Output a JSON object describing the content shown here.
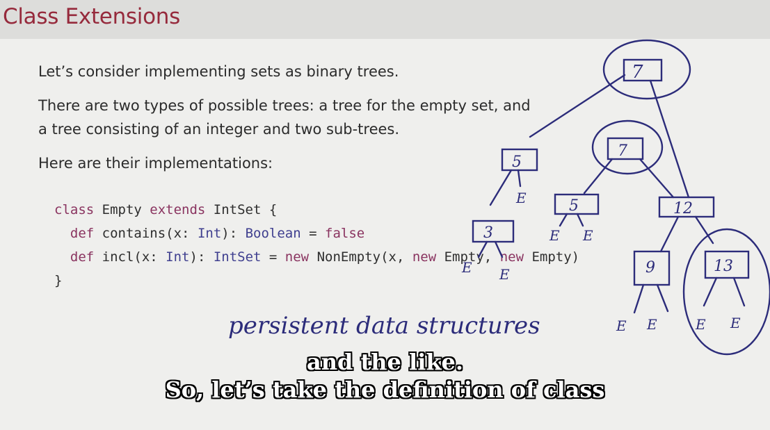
{
  "slide": {
    "title": "Class Extensions",
    "paragraphs": [
      "Let’s consider implementing sets as binary trees.",
      "There are two types of possible trees: a tree for the empty set, and",
      "a tree consisting of an integer and two sub-trees.",
      "Here are their implementations:"
    ],
    "code": {
      "line1": {
        "kw1": "class",
        "name": " Empty ",
        "kw2": "extends",
        "type": " IntSet",
        "rest": " {"
      },
      "line2": {
        "indent": "  ",
        "kw": "def",
        "sig": " contains(x: ",
        "type1": "Int",
        "mid": "): ",
        "type2": "Boolean",
        "eq": " = ",
        "val": "false"
      },
      "line3": {
        "indent": "  ",
        "kw": "def",
        "sig": " incl(x: ",
        "type1": "Int",
        "mid": "): ",
        "type2": "IntSet",
        "eq": " = ",
        "kw2": "new",
        "call": " NonEmpty(x, ",
        "kw3": "new",
        "e1": " Empty, ",
        "kw4": "new",
        "e2": " Empty)"
      },
      "line4": "}"
    }
  },
  "annotations": {
    "handwriting": "persistent data structures",
    "tree_nodes": [
      "7",
      "5",
      "7",
      "5",
      "12",
      "3",
      "9",
      "13"
    ],
    "empty_leaf": "E",
    "ink_color": "#2c2c7a"
  },
  "subtitles": {
    "line1": "and the like.",
    "line2": "So, let’s take the definition of class"
  },
  "colors": {
    "title": "#962a3c",
    "keyword": "#8a3460",
    "type": "#3f3f8f"
  }
}
